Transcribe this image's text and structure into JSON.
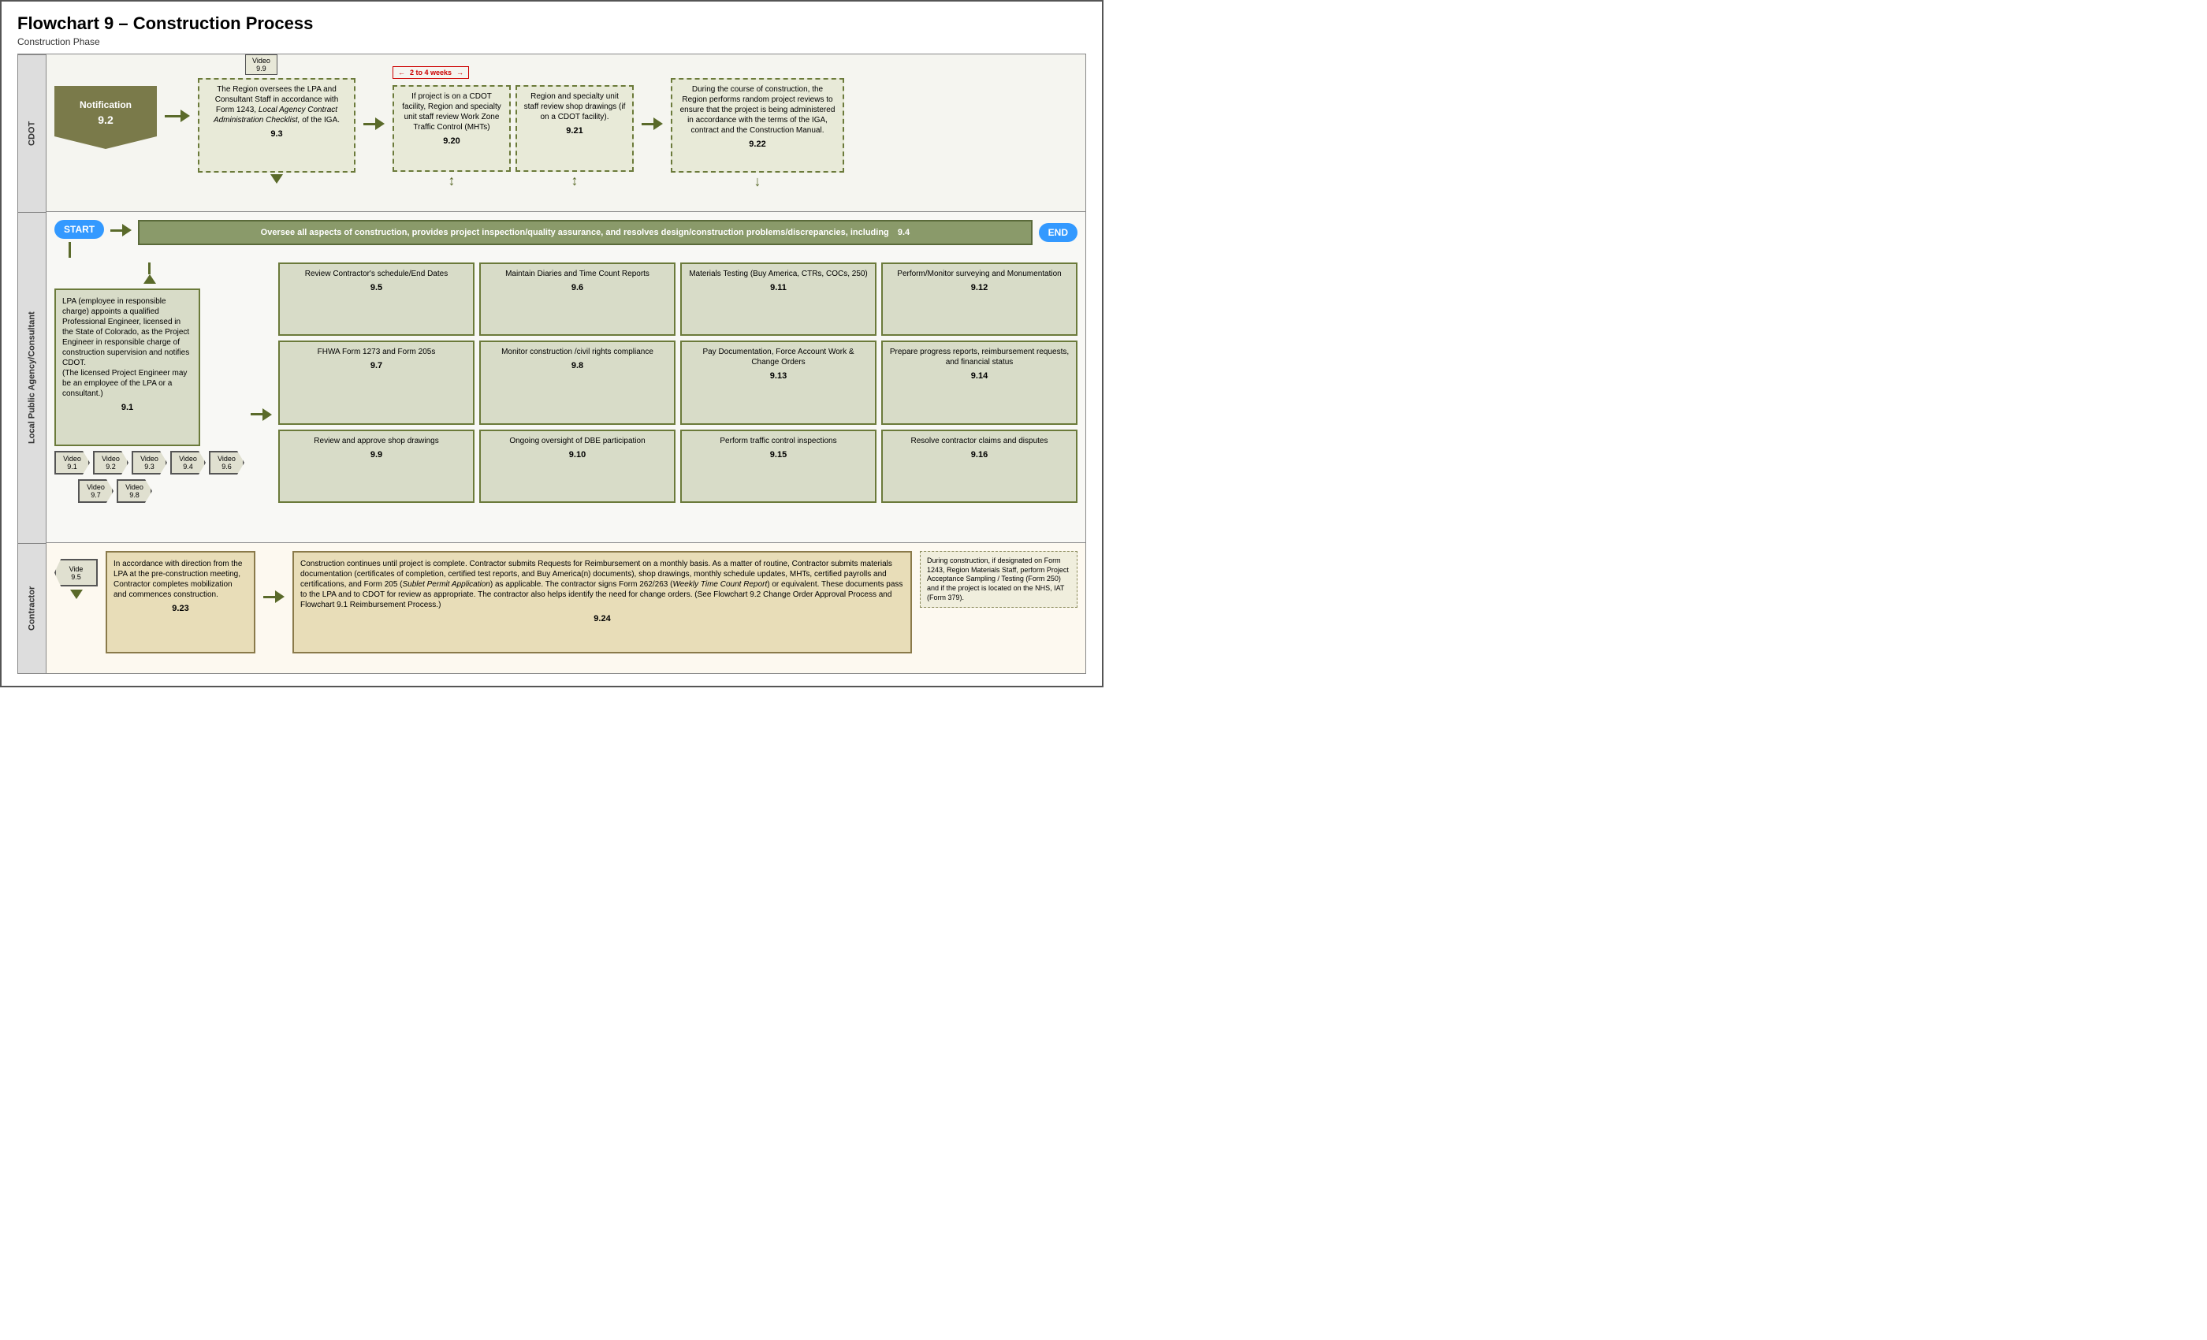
{
  "title": "Flowchart 9 – Construction Process",
  "phase": "Construction Phase",
  "cdot_label": "CDOT",
  "lpa_label": "Local Public Agency/Consultant",
  "contractor_label": "Contractor",
  "notification": {
    "label": "Notification",
    "number": "9.2"
  },
  "video_badge_top": {
    "label": "Video",
    "number": "9.9"
  },
  "weeks_label": "2 to 4 weeks",
  "cdot_boxes": [
    {
      "text": "The Region oversees the LPA and Consultant Staff in accordance with Form 1243, Local Agency Contract Administration Checklist, of the IGA.",
      "number": "9.3",
      "italic_part": "Local Agency Contract Administration Checklist,"
    },
    {
      "text": "If project is on a CDOT facility, Region and specialty unit staff review Work Zone Traffic Control (MHTs)",
      "number": "9.20"
    },
    {
      "text": "Region and specialty unit staff review shop drawings (if on a CDOT facility).",
      "number": "9.21"
    },
    {
      "text": "During the course of construction, the Region performs random project reviews to ensure that the project is being administered in accordance with the terms of the IGA, contract and the Construction Manual.",
      "number": "9.22"
    }
  ],
  "start_label": "START",
  "end_label": "END",
  "main_banner": {
    "text": "Oversee all aspects of construction, provides project  inspection/quality assurance, and resolves design/construction problems/discrepancies, including",
    "number": "9.4"
  },
  "lpa_description": {
    "text": "LPA (employee in responsible charge) appoints a qualified Professional Engineer, licensed in the State of Colorado, as the Project Engineer in responsible charge of construction supervision and notifies CDOT.\n(The licensed Project Engineer may be an employee of the LPA or a consultant.)",
    "number": "9.1"
  },
  "lpa_video_badges": [
    {
      "label": "Video",
      "number": "9.1"
    },
    {
      "label": "Video",
      "number": "9.2"
    },
    {
      "label": "Video",
      "number": "9.3"
    },
    {
      "label": "Video",
      "number": "9.4"
    },
    {
      "label": "Video",
      "number": "9.6"
    }
  ],
  "lpa_video_badges2": [
    {
      "label": "Video",
      "number": "9.7"
    },
    {
      "label": "Video",
      "number": "9.8"
    }
  ],
  "lpa_boxes": [
    {
      "text": "Review Contractor's schedule/End Dates",
      "number": "9.5"
    },
    {
      "text": "Maintain Diaries and Time Count Reports",
      "number": "9.6"
    },
    {
      "text": "Materials Testing (Buy America, CTRs, COCs, 250)",
      "number": "9.11"
    },
    {
      "text": "Perform/Monitor surveying and Monumentation",
      "number": "9.12"
    },
    {
      "text": "FHWA Form 1273 and Form 205s",
      "number": "9.7"
    },
    {
      "text": "Monitor construction /civil rights compliance",
      "number": "9.8"
    },
    {
      "text": "Pay Documentation, Force Account Work & Change Orders",
      "number": "9.13"
    },
    {
      "text": "Prepare progress reports, reimbursement requests, and financial status",
      "number": "9.14"
    },
    {
      "text": "Review and approve shop drawings",
      "number": "9.9"
    },
    {
      "text": "Ongoing oversight of DBE participation",
      "number": "9.10"
    },
    {
      "text": "Perform traffic control inspections",
      "number": "9.15"
    },
    {
      "text": "Resolve contractor claims and disputes",
      "number": "9.16"
    }
  ],
  "contractor_boxes": [
    {
      "label": "Vide",
      "number": "9.5"
    }
  ],
  "contractor_box1": {
    "text": "In accordance with direction from the LPA at the pre-construction meeting, Contractor completes mobilization and commences construction.",
    "number": "9.23"
  },
  "contractor_box2": {
    "text": "Construction continues until project is complete. Contractor submits Requests for Reimbursement on a monthly basis.   As a matter of routine, Contractor submits materials documentation (certificates of completion, certified test reports, and Buy America(n) documents), shop drawings, monthly schedule updates, MHTs, certified payrolls and certifications, and Form 205 (Sublet Permit Application) as applicable. The contractor signs Form 262/263 (Weekly Time Count Report) or equivalent.  These documents pass to the LPA and to CDOT for review as appropriate.   The contractor also helps identify the need for change orders.  (See Flowchart 9.2 Change Order Approval Process and Flowchart 9.1 Reimbursement Process.)",
    "number": "9.24",
    "italic_parts": [
      "Sublet Permit Application",
      "Weekly Time Count Report"
    ]
  },
  "contractor_note": {
    "text": "During construction, if designated on Form 1243, Region Materials Staff, perform Project Acceptance Sampling / Testing (Form 250) and if the project is located on the NHS, IAT (Form 379)."
  }
}
